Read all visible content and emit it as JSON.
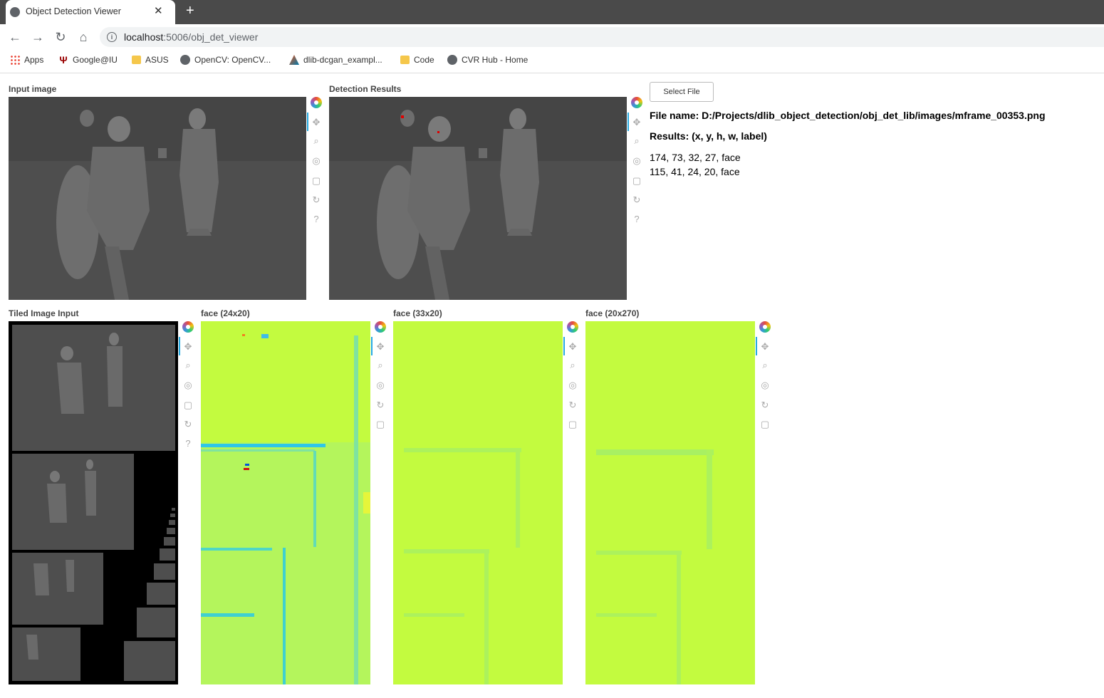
{
  "browser": {
    "tab_title": "Object Detection Viewer",
    "url_host": "localhost",
    "url_rest": ":5006/obj_det_viewer",
    "bookmarks": [
      "Apps",
      "Google@IU",
      "ASUS",
      "OpenCV: OpenCV...",
      "dlib-dcgan_exampl...",
      "Code",
      "CVR Hub - Home"
    ]
  },
  "panels": {
    "input_label": "Input image",
    "detection_label": "Detection Results",
    "tiled_label": "Tiled Image Input",
    "heatmap_labels": [
      "face (24x20)",
      "face (33x20)",
      "face (20x270)"
    ]
  },
  "controls": {
    "select_file": "Select File"
  },
  "results": {
    "file_name": "File name: D:/Projects/dlib_object_detection/obj_det_lib/images/mframe_00353.png",
    "header": "Results: (x, y, h, w, label)",
    "lines": [
      "174, 73, 32, 27, face",
      "115, 41, 24, 20, face"
    ]
  },
  "colors": {
    "heatmap_base": "#c3fb3f",
    "heatmap_low": "#26d4e6",
    "thermal_bg": "#4d4d4d"
  },
  "icons": [
    "bokeh-logo-icon",
    "pan-icon",
    "box-zoom-icon",
    "wheel-zoom-icon",
    "save-icon",
    "reset-icon",
    "help-icon"
  ]
}
